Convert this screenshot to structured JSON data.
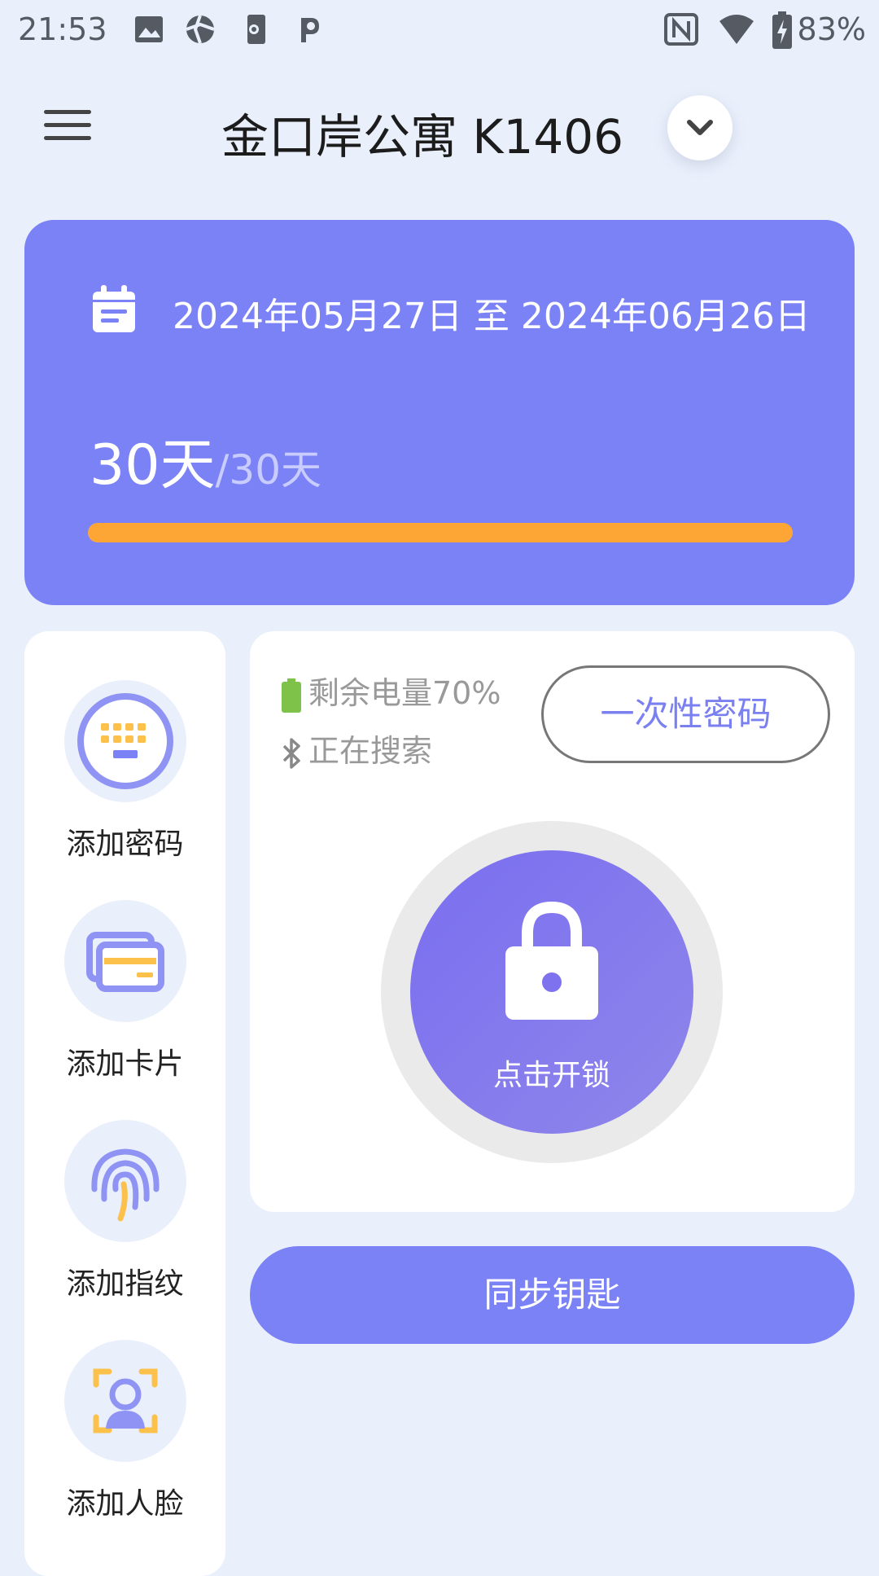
{
  "status_bar": {
    "time": "21:53",
    "battery_percent": "83%",
    "icons": [
      "image-icon",
      "aperture-icon",
      "device-settings-icon",
      "p-icon",
      "nfc-icon",
      "wifi-icon",
      "battery-charging-icon"
    ]
  },
  "header": {
    "title": "金口岸公寓 K1406",
    "menu_icon": "hamburger-menu-icon",
    "dropdown_icon": "chevron-down-icon"
  },
  "lease": {
    "date_range": "2024年05月27日 至 2024年06月26日",
    "days_remaining": "30天",
    "days_total": "/30天",
    "progress_fraction": 1.0,
    "progress_color": "#fda636",
    "card_color": "#7a82f5"
  },
  "sidebar": {
    "items": [
      {
        "label": "添加密码",
        "icon": "keypad-icon"
      },
      {
        "label": "添加卡片",
        "icon": "card-icon"
      },
      {
        "label": "添加指纹",
        "icon": "fingerprint-icon"
      },
      {
        "label": "添加人脸",
        "icon": "face-scan-icon"
      }
    ]
  },
  "lock": {
    "battery_text": "剩余电量70%",
    "bluetooth_text": "正在搜索",
    "otp_button": "一次性密码",
    "unlock_label": "点击开锁"
  },
  "sync_button": "同步钥匙"
}
